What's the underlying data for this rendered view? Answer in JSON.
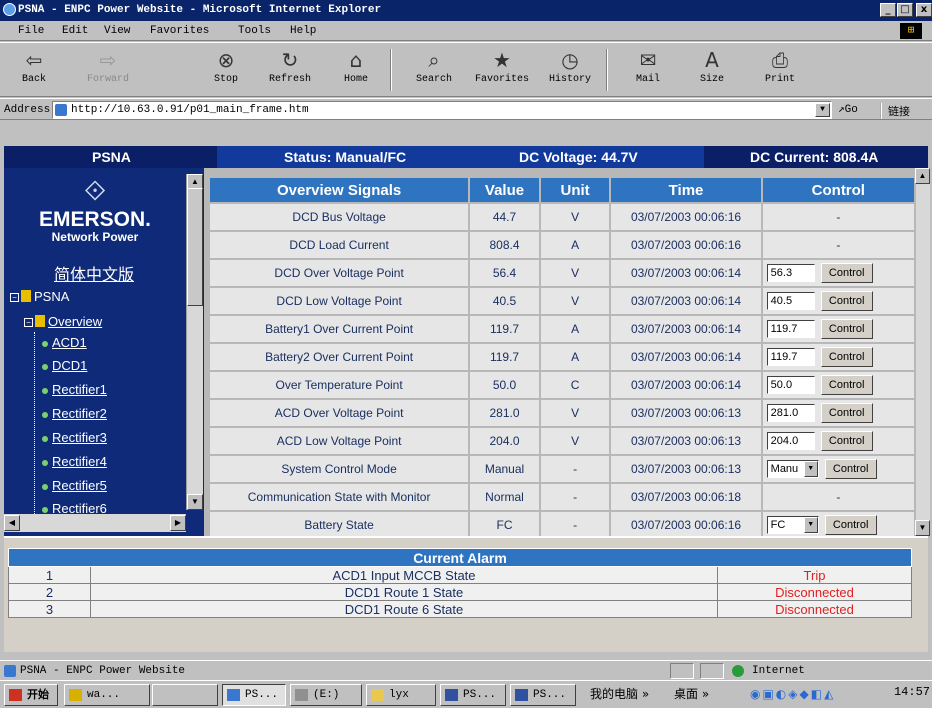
{
  "window": {
    "title": "PSNA - ENPC Power Website - Microsoft Internet Explorer",
    "controls": {
      "minimize": "_",
      "maximize": "□",
      "close": "x"
    }
  },
  "menu": {
    "items": [
      "File",
      "Edit",
      "View",
      "Favorites",
      "Tools",
      "Help"
    ]
  },
  "toolbar": {
    "buttons": [
      {
        "label": "Back",
        "icon": "back-arrow-icon",
        "glyph": "⇦"
      },
      {
        "label": "Forward",
        "icon": "forward-arrow-icon",
        "glyph": "⇨"
      },
      {
        "label": "Stop",
        "icon": "stop-icon",
        "glyph": "⊗"
      },
      {
        "label": "Refresh",
        "icon": "refresh-icon",
        "glyph": "↻"
      },
      {
        "label": "Home",
        "icon": "home-icon",
        "glyph": "⌂"
      },
      {
        "label": "Search",
        "icon": "search-icon",
        "glyph": "⌕"
      },
      {
        "label": "Favorites",
        "icon": "favorites-icon",
        "glyph": "★"
      },
      {
        "label": "History",
        "icon": "history-icon",
        "glyph": "◷"
      },
      {
        "label": "Mail",
        "icon": "mail-icon",
        "glyph": "✉"
      },
      {
        "label": "Size",
        "icon": "size-icon",
        "glyph": "A"
      },
      {
        "label": "Print",
        "icon": "print-icon",
        "glyph": "⎙"
      }
    ]
  },
  "address": {
    "label": "Address",
    "url": "http://10.63.0.91/p01_main_frame.htm",
    "go": "Go",
    "links": "链接"
  },
  "header": {
    "site": "PSNA",
    "status": "Status: Manual/FC",
    "voltage": "DC Voltage: 44.7V",
    "current": "DC Current: 808.4A"
  },
  "nav": {
    "brand": "EMERSON.",
    "brand_sub": "Network Power",
    "chinese_link": "简体中文版",
    "root": "PSNA",
    "overview": "Overview",
    "items": [
      "ACD1",
      "DCD1",
      "Rectifier1",
      "Rectifier2",
      "Rectifier3",
      "Rectifier4",
      "Rectifier5",
      "Rectifier6"
    ]
  },
  "signals": {
    "headers": [
      "Overview Signals",
      "Value",
      "Unit",
      "Time",
      "Control"
    ],
    "control_label": "Control",
    "rows": [
      {
        "name": "DCD Bus Voltage",
        "value": "44.7",
        "unit": "V",
        "time": "03/07/2003 00:06:16",
        "control": "-"
      },
      {
        "name": "DCD Load Current",
        "value": "808.4",
        "unit": "A",
        "time": "03/07/2003 00:06:16",
        "control": "-"
      },
      {
        "name": "DCD Over Voltage Point",
        "value": "56.4",
        "unit": "V",
        "time": "03/07/2003 00:06:14",
        "input": "56.3"
      },
      {
        "name": "DCD Low Voltage Point",
        "value": "40.5",
        "unit": "V",
        "time": "03/07/2003 00:06:14",
        "input": "40.5"
      },
      {
        "name": "Battery1 Over Current Point",
        "value": "119.7",
        "unit": "A",
        "time": "03/07/2003 00:06:14",
        "input": "119.7"
      },
      {
        "name": "Battery2 Over Current Point",
        "value": "119.7",
        "unit": "A",
        "time": "03/07/2003 00:06:14",
        "input": "119.7"
      },
      {
        "name": "Over Temperature Point",
        "value": "50.0",
        "unit": "C",
        "time": "03/07/2003 00:06:14",
        "input": "50.0"
      },
      {
        "name": "ACD Over Voltage Point",
        "value": "281.0",
        "unit": "V",
        "time": "03/07/2003 00:06:13",
        "input": "281.0"
      },
      {
        "name": "ACD Low Voltage Point",
        "value": "204.0",
        "unit": "V",
        "time": "03/07/2003 00:06:13",
        "input": "204.0"
      },
      {
        "name": "System Control Mode",
        "value": "Manual",
        "unit": "-",
        "time": "03/07/2003 00:06:13",
        "select": "Manu"
      },
      {
        "name": "Communication State with Monitor",
        "value": "Normal",
        "unit": "-",
        "time": "03/07/2003 00:06:18",
        "control": "-"
      },
      {
        "name": "Battery State",
        "value": "FC",
        "unit": "-",
        "time": "03/07/2003 00:06:16",
        "select": "FC"
      }
    ]
  },
  "alarms": {
    "title": "Current Alarm",
    "rows": [
      {
        "no": "1",
        "name": "ACD1 Input MCCB State",
        "state": "Trip"
      },
      {
        "no": "2",
        "name": "DCD1 Route 1 State",
        "state": "Disconnected"
      },
      {
        "no": "3",
        "name": "DCD1 Route 6 State",
        "state": "Disconnected"
      }
    ],
    "state_color": "#e02020"
  },
  "statusbar": {
    "text": "PSNA - ENPC Power Website",
    "zone": "Internet"
  },
  "taskbar": {
    "start": "开始",
    "buttons": [
      "wa...",
      "",
      "PS...",
      "(E:)",
      "lyx",
      "PS...",
      "PS..."
    ],
    "tray_mycomputer": "我的电脑 »",
    "tray_desktop": "桌面 »",
    "clock": "14:57"
  },
  "colors": {
    "header_bg": "#0b1f66",
    "nav_bg": "#0e2a78",
    "table_header": "#2e74c0",
    "alarm_text": "#e02020"
  }
}
